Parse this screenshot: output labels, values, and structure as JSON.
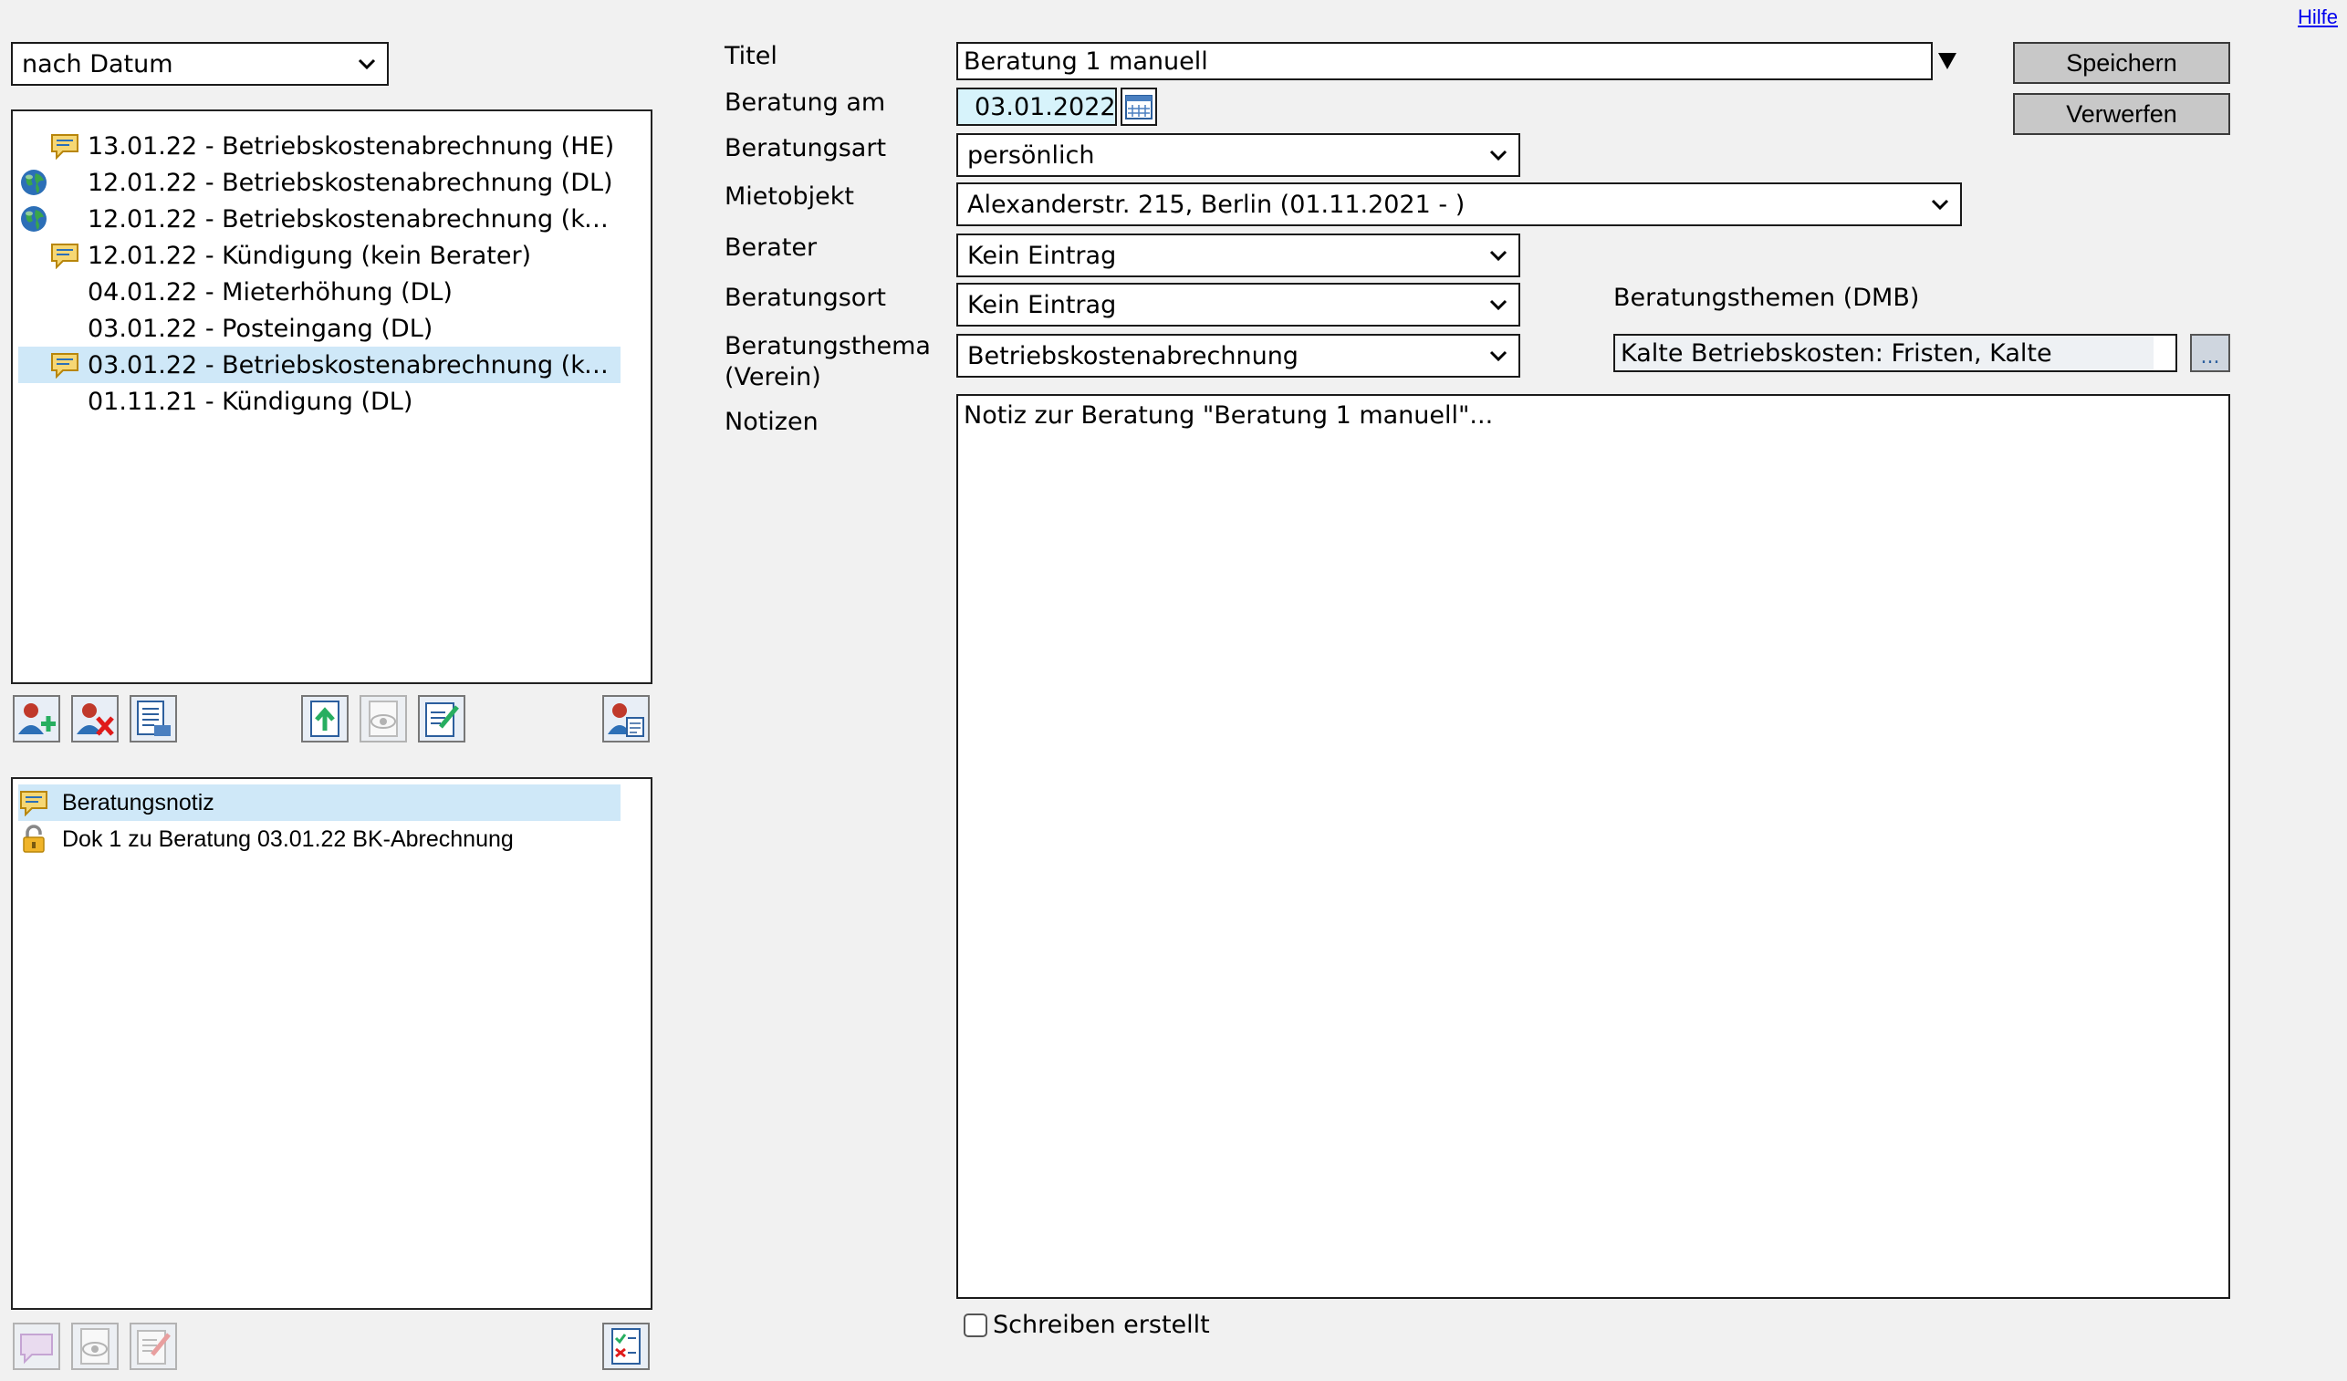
{
  "help_link": "Hilfe",
  "sort": {
    "selected": "nach Datum"
  },
  "consultations": [
    {
      "label": "13.01.22 - Betriebskostenabrechnung (HE)",
      "icon": "note-icon",
      "selected": false
    },
    {
      "label": "12.01.22 - Betriebskostenabrechnung (DL)",
      "icon": "globe-icon",
      "selected": false
    },
    {
      "label": "12.01.22 - Betriebskostenabrechnung (kei…",
      "icon": "globe-icon",
      "selected": false
    },
    {
      "label": "12.01.22 - Kündigung (kein Berater)",
      "icon": "note-icon",
      "selected": false
    },
    {
      "label": "04.01.22 - Mieterhöhung (DL)",
      "icon": "",
      "selected": false
    },
    {
      "label": "03.01.22 - Posteingang (DL)",
      "icon": "",
      "selected": false
    },
    {
      "label": "03.01.22 - Betriebskostenabrechnung (kei…",
      "icon": "note-icon",
      "selected": true
    },
    {
      "label": "01.11.21 - Kündigung (DL)",
      "icon": "",
      "selected": false
    }
  ],
  "documents": [
    {
      "label": "Beratungsnotiz",
      "icon": "note-icon",
      "selected": true
    },
    {
      "label": "Dok 1 zu Beratung 03.01.22 BK-Abrechnung",
      "icon": "lock-icon",
      "selected": false
    }
  ],
  "form": {
    "title_label": "Titel",
    "title_value": "Beratung 1 manuell",
    "date_label": "Beratung am",
    "date_value": "03.01.2022",
    "type_label": "Beratungsart",
    "type_value": "persönlich",
    "object_label": "Mietobjekt",
    "object_value": "Alexanderstr. 215, Berlin (01.11.2021 - )",
    "advisor_label": "Berater",
    "advisor_value": "Kein Eintrag",
    "place_label": "Beratungsort",
    "place_value": "Kein Eintrag",
    "topic_label_1": "Beratungsthema",
    "topic_label_2": "(Verein)",
    "topic_value": "Betriebskostenabrechnung",
    "dmb_label": "Beratungsthemen (DMB)",
    "dmb_value": "Kalte Betriebskosten: Fristen, Kalte",
    "dmb_button": "...",
    "notes_label": "Notizen",
    "notes_value": "Notiz zur Beratung \"Beratung 1 manuell\"...",
    "letter_label": "Schreiben erstellt"
  },
  "buttons": {
    "save": "Speichern",
    "discard": "Verwerfen"
  }
}
